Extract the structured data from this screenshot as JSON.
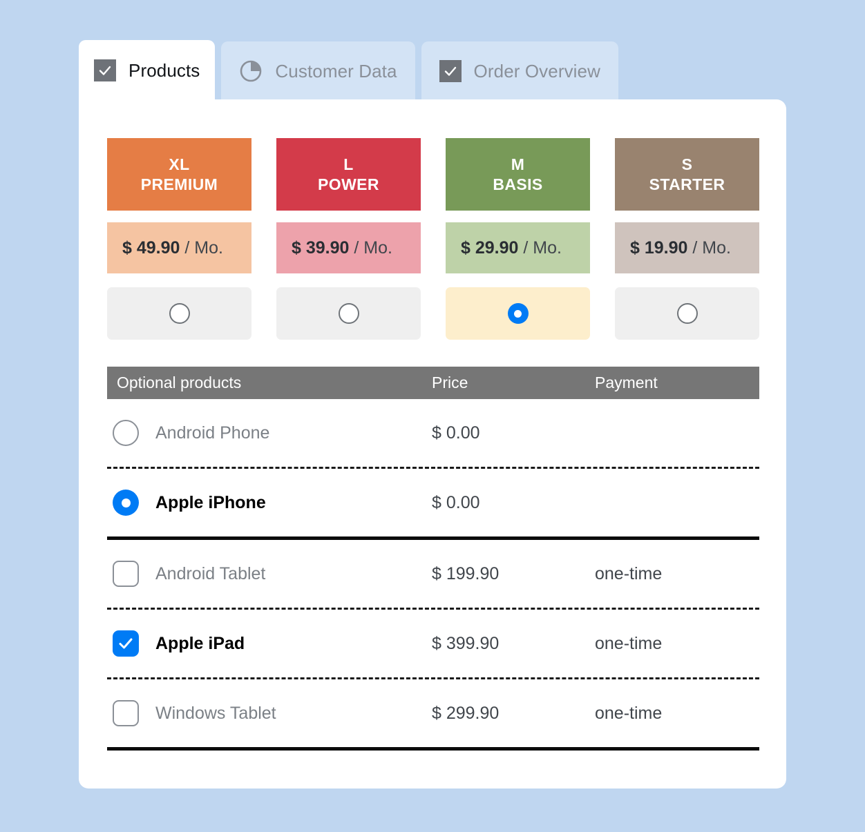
{
  "theme": {
    "page_background": "#bfd6f0",
    "panel_background": "#ffffff",
    "tab_inactive_background": "#d3e3f5",
    "accent_blue": "#007bf5",
    "selected_plan_background": "#fdeecc",
    "table_header_background": "#767676"
  },
  "tabs": [
    {
      "label": "Products",
      "icon": "checkbox-checked-icon",
      "active": true
    },
    {
      "label": "Customer Data",
      "icon": "pie-chart-icon",
      "active": false
    },
    {
      "label": "Order Overview",
      "icon": "checkbox-checked-icon",
      "active": false
    }
  ],
  "plans": [
    {
      "size": "XL",
      "name": "PREMIUM",
      "price_amount": "$ 49.90",
      "price_unit": "/ Mo.",
      "header_color": "#e57d45",
      "price_color": "#f5c4a2",
      "selected": false
    },
    {
      "size": "L",
      "name": "POWER",
      "price_amount": "$ 39.90",
      "price_unit": "/ Mo.",
      "header_color": "#d33b4a",
      "price_color": "#eda2ab",
      "selected": false
    },
    {
      "size": "M",
      "name": "BASIS",
      "price_amount": "$ 29.90",
      "price_unit": "/ Mo.",
      "header_color": "#789a58",
      "price_color": "#bed2a8",
      "selected": true
    },
    {
      "size": "S",
      "name": "STARTER",
      "price_amount": "$ 19.90",
      "price_unit": "/ Mo.",
      "header_color": "#99836f",
      "price_color": "#cfc3bd",
      "selected": false
    }
  ],
  "options_table": {
    "columns": {
      "name": "Optional products",
      "price": "Price",
      "payment": "Payment"
    },
    "rows": [
      {
        "label": "Android Phone",
        "price": "$ 0.00",
        "payment": "",
        "control": "radio",
        "selected": false
      },
      {
        "label": "Apple iPhone",
        "price": "$ 0.00",
        "payment": "",
        "control": "radio",
        "selected": true
      },
      {
        "label": "Android Tablet",
        "price": "$ 199.90",
        "payment": "one-time",
        "control": "checkbox",
        "selected": false
      },
      {
        "label": "Apple iPad",
        "price": "$ 399.90",
        "payment": "one-time",
        "control": "checkbox",
        "selected": true
      },
      {
        "label": "Windows Tablet",
        "price": "$ 299.90",
        "payment": "one-time",
        "control": "checkbox",
        "selected": false
      }
    ]
  }
}
